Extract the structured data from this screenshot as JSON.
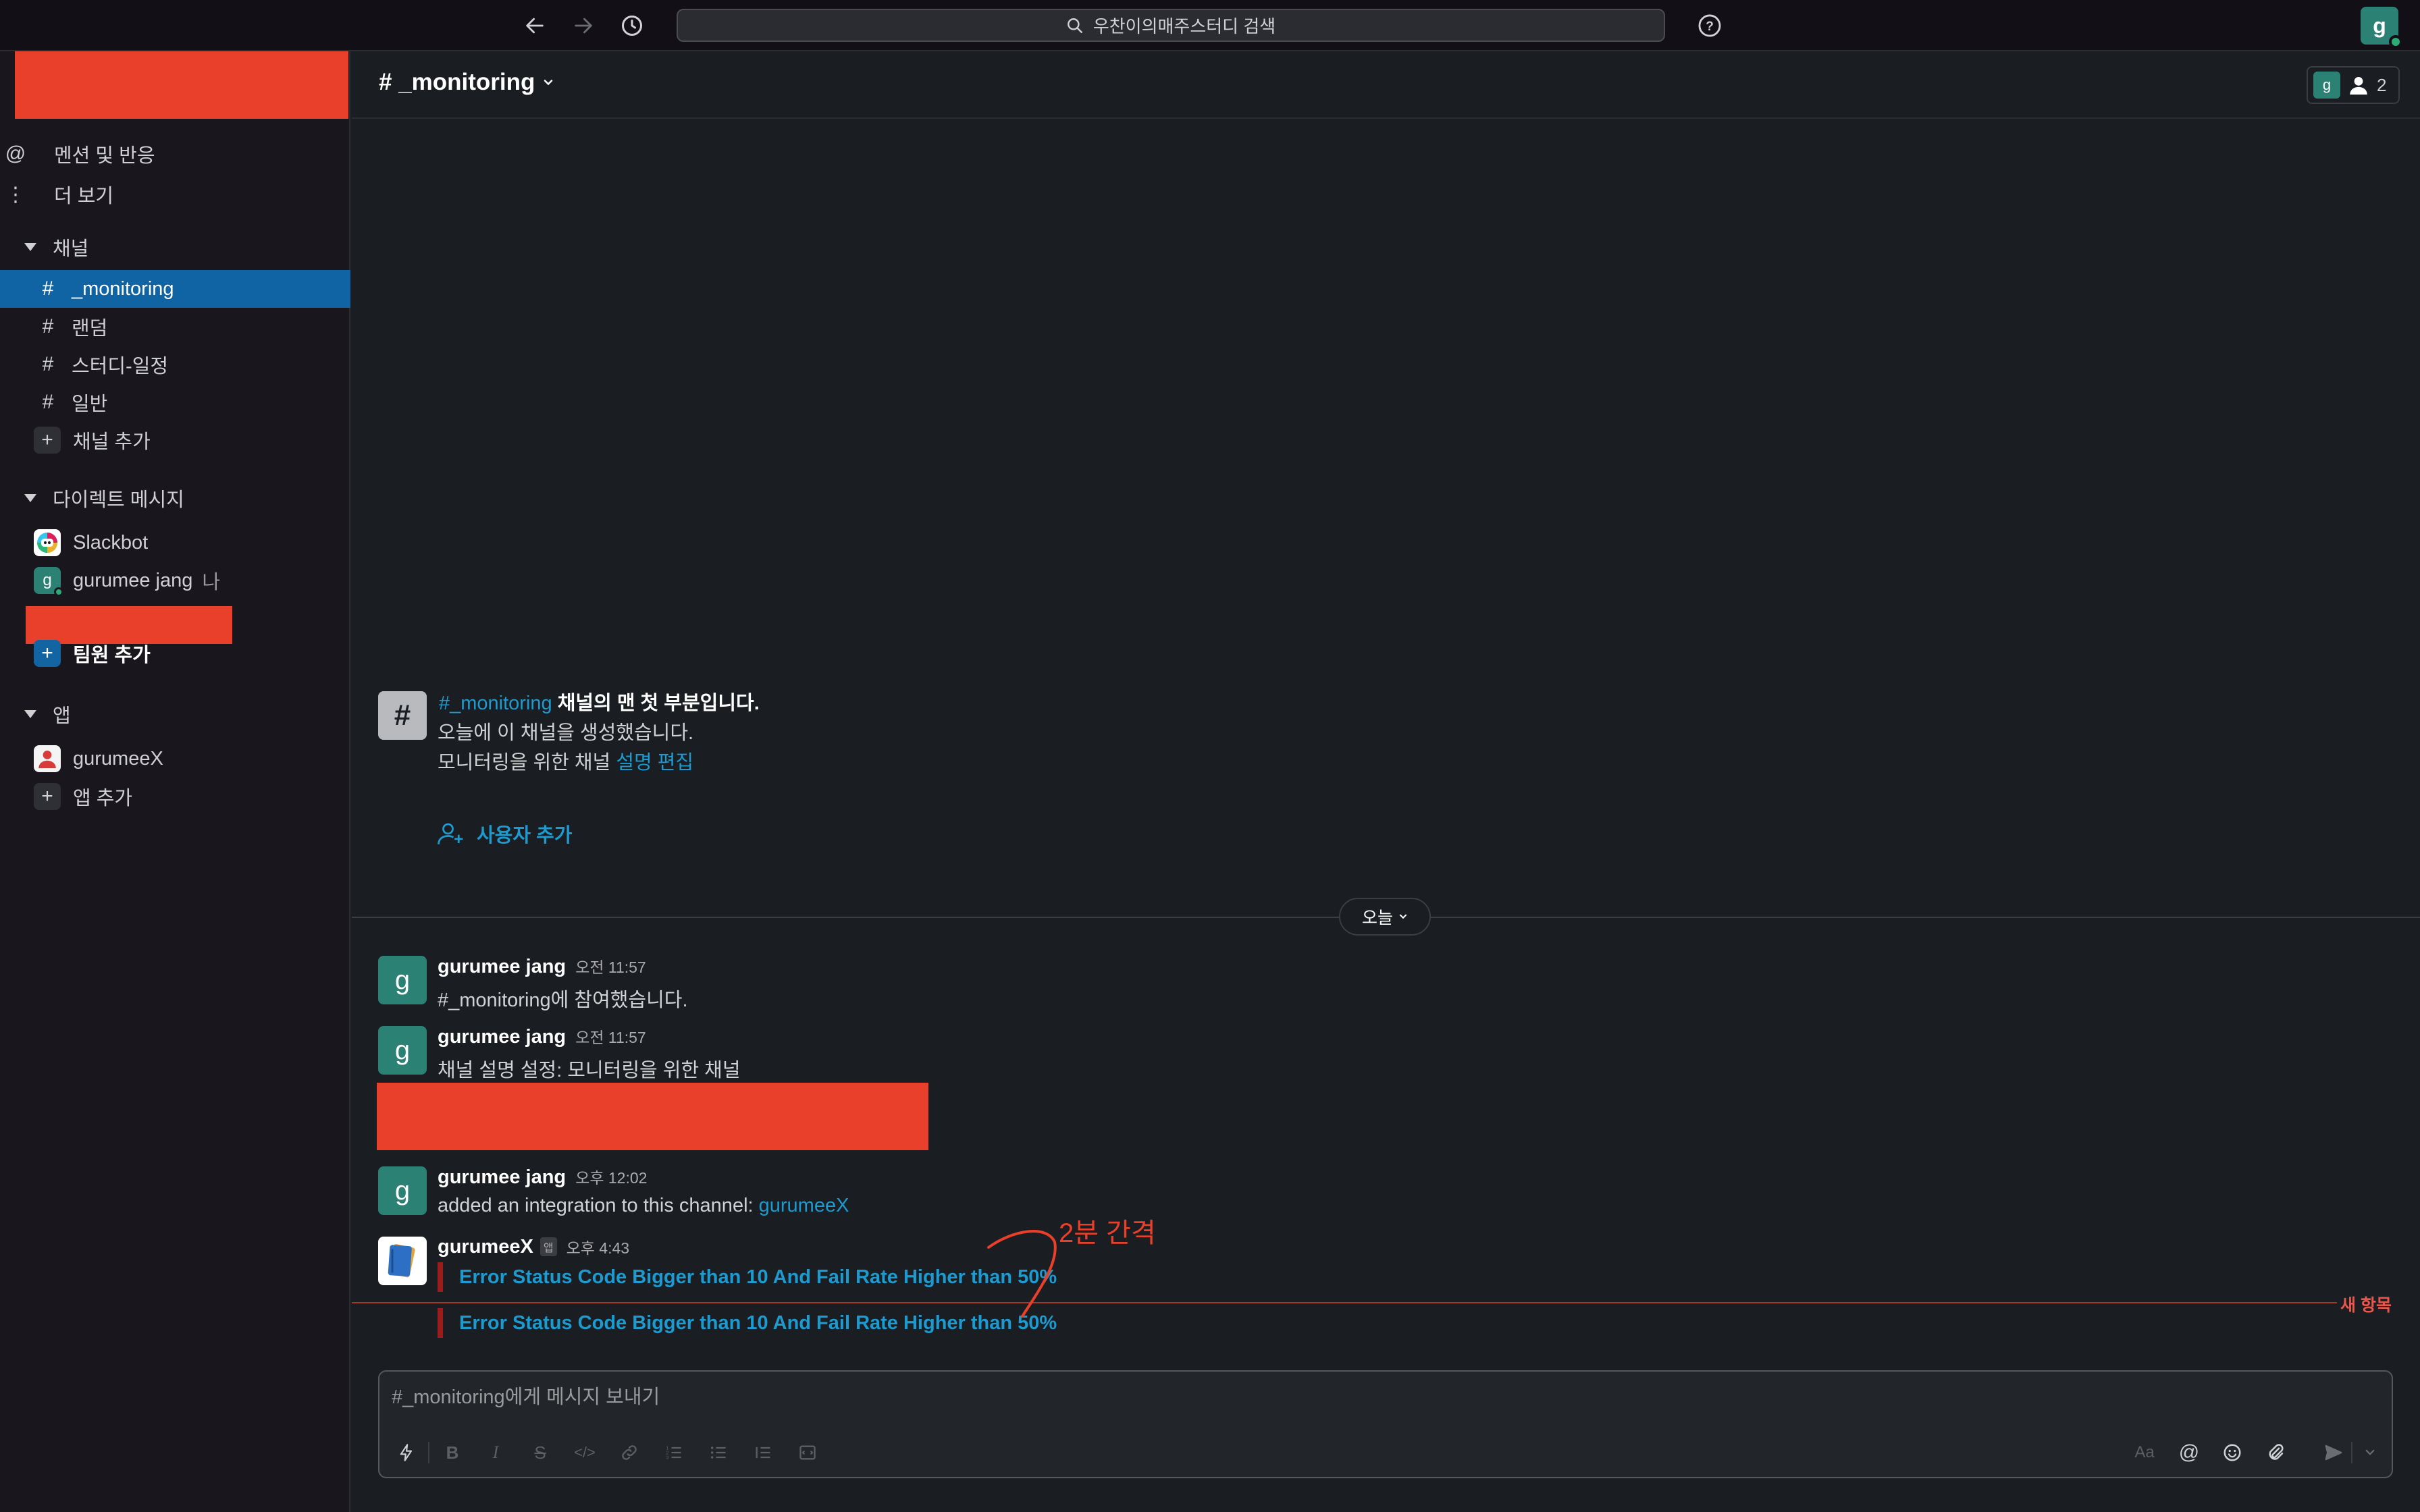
{
  "topbar": {
    "search_placeholder": "우찬이의매주스터디 검색",
    "user_initial": "g"
  },
  "sidebar": {
    "mentions_label": "멘션 및 반응",
    "more_label": "더 보기",
    "channels_header": "채널",
    "channels": [
      {
        "name": "_monitoring",
        "active": true
      },
      {
        "name": "랜덤"
      },
      {
        "name": "스터디-일정"
      },
      {
        "name": "일반"
      }
    ],
    "add_channel": "채널 추가",
    "dm_header": "다이렉트 메시지",
    "dms": [
      {
        "name": "Slackbot"
      },
      {
        "name": "gurumee jang",
        "suffix": "나",
        "initial": "g"
      }
    ],
    "add_member": "팀원 추가",
    "apps_header": "앱",
    "apps": [
      {
        "name": "gurumeeX"
      }
    ],
    "add_app": "앱 추가"
  },
  "header": {
    "channel_title": "# _monitoring",
    "member_initial": "g",
    "member_count": "2"
  },
  "intro": {
    "channel_link": "#_monitoring",
    "title_rest": "채널의 맨 첫 부분입니다.",
    "created": "오늘에 이 채널을 생성했습니다.",
    "description": "모니터링을 위한 채널",
    "edit_link": "설명 편집",
    "add_user": "사용자 추가"
  },
  "date_divider": "오늘",
  "messages": [
    {
      "author": "gurumee jang",
      "time": "오전 11:57",
      "text": "#_monitoring에 참여했습니다.",
      "initial": "g"
    },
    {
      "author": "gurumee jang",
      "time": "오전 11:57",
      "text": "채널 설명 설정: 모니터링을 위한 채널",
      "initial": "g"
    },
    {
      "author": "gurumee jang",
      "time": "오후 12:02",
      "text": "added an integration to this channel: ",
      "link": "gurumeeX",
      "initial": "g"
    },
    {
      "author": "gurumeeX",
      "badge": "앱",
      "time": "오후 4:43",
      "attachments": [
        "Error Status Code Bigger than 10 And Fail Rate Higher than 50%",
        "Error Status Code Bigger than 10 And Fail Rate Higher than 50%"
      ]
    }
  ],
  "new_items_label": "새 항목",
  "annotation": "2분 간격",
  "composer": {
    "placeholder": "#_monitoring에게 메시지 보내기",
    "format_label": "Aa"
  },
  "colors": {
    "sidebar_active": "#1164a3",
    "link": "#1d9bd1",
    "redaction": "#e8402a",
    "avatar": "#2b8274"
  }
}
